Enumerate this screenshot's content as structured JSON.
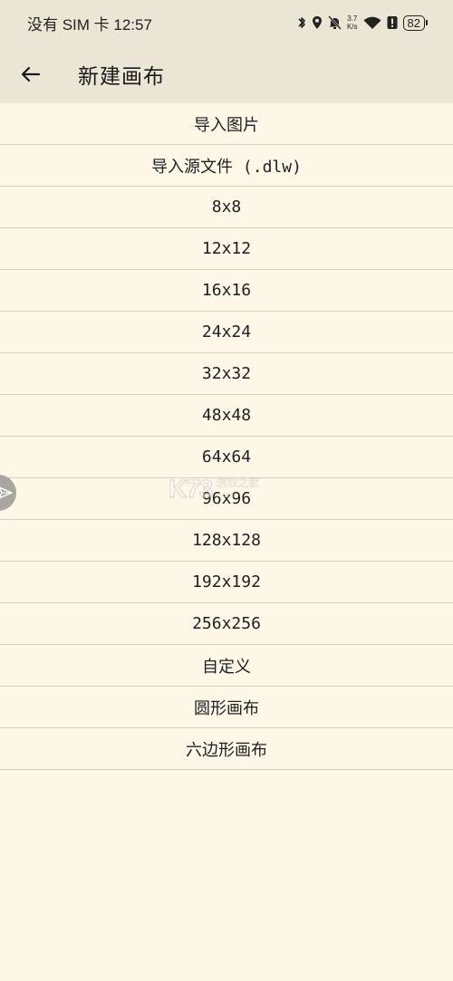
{
  "status_bar": {
    "carrier_time": "没有 SIM 卡 12:57",
    "net_speed_value": "3.7",
    "net_speed_unit": "K/s",
    "battery": "82",
    "icons": [
      "bluetooth-icon",
      "location-icon",
      "mute-bell-icon",
      "wifi-icon",
      "alert-icon",
      "battery-icon"
    ]
  },
  "app_bar": {
    "back_icon": "arrow-left-icon",
    "title": "新建画布"
  },
  "menu": {
    "items": [
      {
        "label": "导入图片"
      },
      {
        "label": "导入源文件 (.dlw)"
      },
      {
        "label": "8x8"
      },
      {
        "label": "12x12"
      },
      {
        "label": "16x16"
      },
      {
        "label": "24x24"
      },
      {
        "label": "32x32"
      },
      {
        "label": "48x48"
      },
      {
        "label": "64x64"
      },
      {
        "label": "96x96"
      },
      {
        "label": "128x128"
      },
      {
        "label": "192x192"
      },
      {
        "label": "256x256"
      },
      {
        "label": "自定义"
      },
      {
        "label": "圆形画布"
      },
      {
        "label": "六边形画布"
      }
    ]
  },
  "watermark": {
    "logo": "K73",
    "name_cn": "游戏之家",
    "domain": ".com"
  },
  "colors": {
    "background": "#fdf7e8",
    "app_bar": "#ebe5d6",
    "divider": "#d4cfc3",
    "float_button": "#a9a6a0"
  }
}
